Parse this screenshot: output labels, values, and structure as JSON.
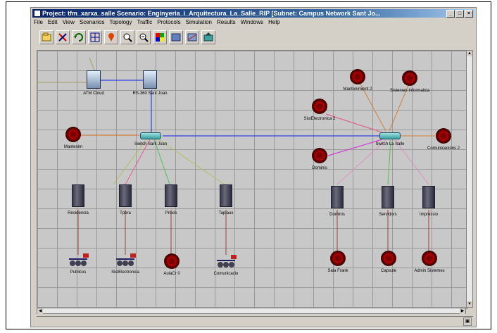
{
  "window": {
    "title": "Project: tfm_xarxa_salle Scenario: Enginyeria_i_Arquitectura_La_Salle_RIP [Subnet: Campus Network Sant Jo...",
    "minimize_label": "_",
    "maximize_label": "□",
    "close_label": "×"
  },
  "menu": [
    "File",
    "Edit",
    "View",
    "Scenarios",
    "Topology",
    "Traffic",
    "Protocols",
    "Simulation",
    "Results",
    "Windows",
    "Help"
  ],
  "toolbar": {
    "buttons": [
      "open-icon",
      "cut-icon",
      "rotate-icon",
      "grid-icon",
      "marker-icon",
      "zoom-in-icon",
      "zoom-out-icon",
      "color-icon",
      "panel-icon",
      "chart-icon",
      "export-icon"
    ]
  },
  "nodes": {
    "atm": "ATM Cloud",
    "router": "RS-360 Sant Joan",
    "mantenim": "Mantenim",
    "switch_left": "Switch Sant Joan",
    "switch_right": "Switch La Salle",
    "mantenimient2": "Mantenimient 2",
    "sistemes": "Sistemes Informatica",
    "sistelectronica2": "SistElectronica 2",
    "comunicacions2": "Comunicacions 2",
    "dominis": "Dominis",
    "serv_residencia": "Residencia",
    "serv_tpera": "Tpera",
    "serv_proxis": "Proxis",
    "serv_tapiaux": "Tapiaux",
    "serv_dominis": "Dominis",
    "serv_servidors": "Servidors",
    "serv_impressio": "Impressio",
    "lan_publicos": "Publicos",
    "lan_sistelectronica": "SistElectronica",
    "eth_aulacr": "AulaCr 0",
    "lan_comunicacio": "Comunicacio",
    "eth_sala_frank": "Sala Frank",
    "eth_capsule": "Capsule",
    "eth_admin": "Admin Sistemes"
  },
  "status": {
    "icon": "status-icon"
  },
  "colors": {
    "titlebar": "#0a246a",
    "canvas": "#c8c8c8",
    "link_orange": "#d08040",
    "link_blue": "#3040e0",
    "link_pink": "#e06090",
    "link_green": "#50c050",
    "link_magenta": "#d040d0",
    "link_red": "#a04040"
  }
}
